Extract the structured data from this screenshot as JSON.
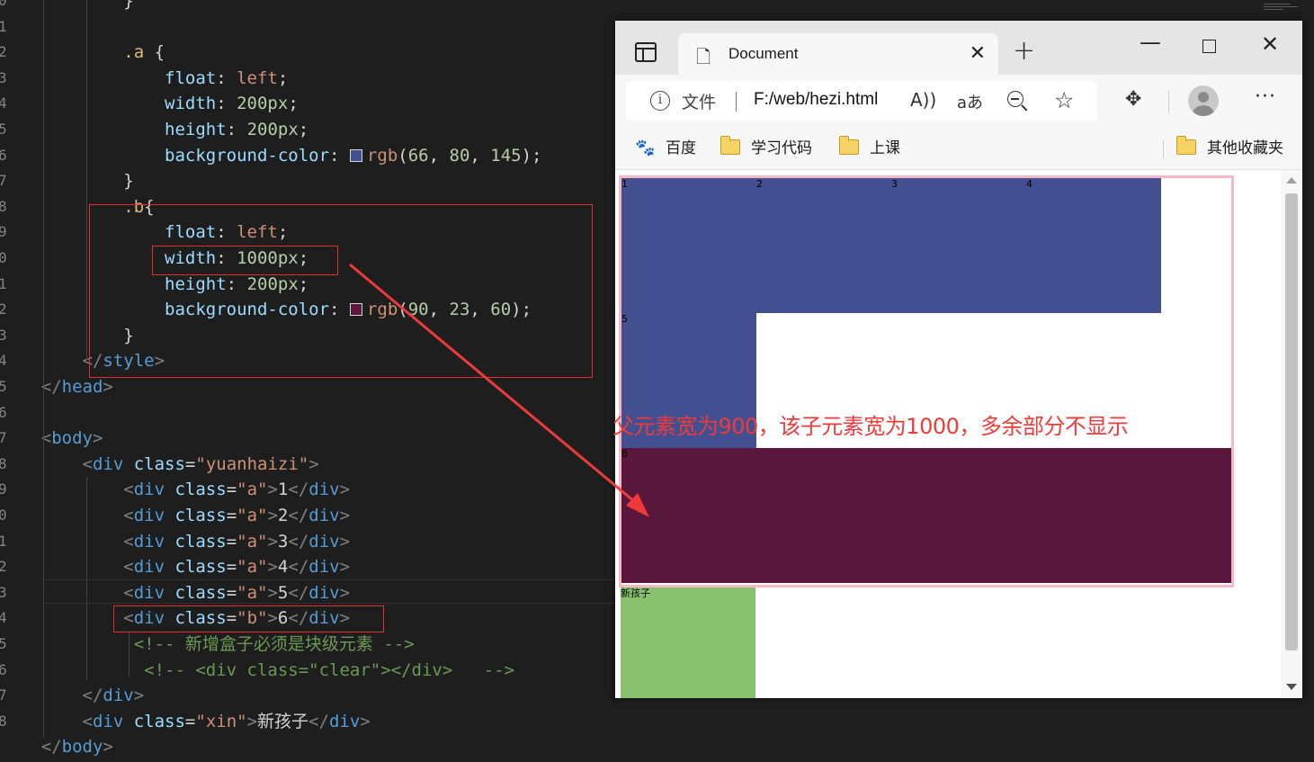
{
  "editor": {
    "gutter": [
      "0",
      "1",
      "2",
      "3",
      "4",
      "5",
      "6",
      "7",
      "8",
      "9",
      "0",
      "1",
      "2",
      "3",
      "4",
      "5",
      "6",
      "7",
      "8",
      "9",
      "0",
      "1",
      "2",
      "3",
      "4",
      "5",
      "6",
      "7",
      "8"
    ],
    "lines": [
      [
        {
          "c": "tk-text",
          "t": "            }"
        }
      ],
      [],
      [
        {
          "c": "tk-sel",
          "t": "            .a "
        },
        {
          "c": "tk-text",
          "t": "{"
        }
      ],
      [
        {
          "c": "tk-prop",
          "t": "                float"
        },
        {
          "c": "tk-text",
          "t": ": "
        },
        {
          "c": "tk-val",
          "t": "left"
        },
        {
          "c": "tk-text",
          "t": ";"
        }
      ],
      [
        {
          "c": "tk-prop",
          "t": "                width"
        },
        {
          "c": "tk-text",
          "t": ": "
        },
        {
          "c": "tk-num",
          "t": "200px"
        },
        {
          "c": "tk-text",
          "t": ";"
        }
      ],
      [
        {
          "c": "tk-prop",
          "t": "                height"
        },
        {
          "c": "tk-text",
          "t": ": "
        },
        {
          "c": "tk-num",
          "t": "200px"
        },
        {
          "c": "tk-text",
          "t": ";"
        }
      ],
      [
        {
          "c": "tk-prop",
          "t": "                background-color"
        },
        {
          "c": "tk-text",
          "t": ": "
        },
        {
          "swatch": "#425091"
        },
        {
          "c": "tk-val",
          "t": "rgb"
        },
        {
          "c": "tk-text",
          "t": "("
        },
        {
          "c": "tk-num",
          "t": "66"
        },
        {
          "c": "tk-text",
          "t": ", "
        },
        {
          "c": "tk-num",
          "t": "80"
        },
        {
          "c": "tk-text",
          "t": ", "
        },
        {
          "c": "tk-num",
          "t": "145"
        },
        {
          "c": "tk-text",
          "t": ");"
        }
      ],
      [
        {
          "c": "tk-text",
          "t": "            }"
        }
      ],
      [
        {
          "c": "tk-sel",
          "t": "            .b"
        },
        {
          "c": "tk-text",
          "t": "{"
        }
      ],
      [
        {
          "c": "tk-prop",
          "t": "                float"
        },
        {
          "c": "tk-text",
          "t": ": "
        },
        {
          "c": "tk-val",
          "t": "left"
        },
        {
          "c": "tk-text",
          "t": ";"
        }
      ],
      [
        {
          "c": "tk-prop",
          "t": "                width"
        },
        {
          "c": "tk-text",
          "t": ": "
        },
        {
          "c": "tk-num",
          "t": "1000px"
        },
        {
          "c": "tk-text",
          "t": ";"
        }
      ],
      [
        {
          "c": "tk-prop",
          "t": "                height"
        },
        {
          "c": "tk-text",
          "t": ": "
        },
        {
          "c": "tk-num",
          "t": "200px"
        },
        {
          "c": "tk-text",
          "t": ";"
        }
      ],
      [
        {
          "c": "tk-prop",
          "t": "                background-color"
        },
        {
          "c": "tk-text",
          "t": ": "
        },
        {
          "swatch": "#5a173c"
        },
        {
          "c": "tk-val",
          "t": "rgb"
        },
        {
          "c": "tk-text",
          "t": "("
        },
        {
          "c": "tk-num",
          "t": "90"
        },
        {
          "c": "tk-text",
          "t": ", "
        },
        {
          "c": "tk-num",
          "t": "23"
        },
        {
          "c": "tk-text",
          "t": ", "
        },
        {
          "c": "tk-num",
          "t": "60"
        },
        {
          "c": "tk-text",
          "t": ");"
        }
      ],
      [
        {
          "c": "tk-text",
          "t": "            }"
        }
      ],
      [
        {
          "c": "tk-punc",
          "t": "        </"
        },
        {
          "c": "tk-tag",
          "t": "style"
        },
        {
          "c": "tk-punc",
          "t": ">"
        }
      ],
      [
        {
          "c": "tk-punc",
          "t": "    </"
        },
        {
          "c": "tk-tag",
          "t": "head"
        },
        {
          "c": "tk-punc",
          "t": ">"
        }
      ],
      [],
      [
        {
          "c": "tk-punc",
          "t": "    <"
        },
        {
          "c": "tk-tag",
          "t": "body"
        },
        {
          "c": "tk-punc",
          "t": ">"
        }
      ],
      [
        {
          "c": "tk-punc",
          "t": "        <"
        },
        {
          "c": "tk-tag",
          "t": "div"
        },
        {
          "c": "tk-attr",
          "t": " class"
        },
        {
          "c": "tk-text",
          "t": "="
        },
        {
          "c": "tk-str",
          "t": "\"yuanhaizi\""
        },
        {
          "c": "tk-punc",
          "t": ">"
        }
      ],
      [
        {
          "c": "tk-punc",
          "t": "            <"
        },
        {
          "c": "tk-tag",
          "t": "div"
        },
        {
          "c": "tk-attr",
          "t": " class"
        },
        {
          "c": "tk-text",
          "t": "="
        },
        {
          "c": "tk-str",
          "t": "\"a\""
        },
        {
          "c": "tk-punc",
          "t": ">"
        },
        {
          "c": "tk-text",
          "t": "1"
        },
        {
          "c": "tk-punc",
          "t": "</"
        },
        {
          "c": "tk-tag",
          "t": "div"
        },
        {
          "c": "tk-punc",
          "t": ">"
        }
      ],
      [
        {
          "c": "tk-punc",
          "t": "            <"
        },
        {
          "c": "tk-tag",
          "t": "div"
        },
        {
          "c": "tk-attr",
          "t": " class"
        },
        {
          "c": "tk-text",
          "t": "="
        },
        {
          "c": "tk-str",
          "t": "\"a\""
        },
        {
          "c": "tk-punc",
          "t": ">"
        },
        {
          "c": "tk-text",
          "t": "2"
        },
        {
          "c": "tk-punc",
          "t": "</"
        },
        {
          "c": "tk-tag",
          "t": "div"
        },
        {
          "c": "tk-punc",
          "t": ">"
        }
      ],
      [
        {
          "c": "tk-punc",
          "t": "            <"
        },
        {
          "c": "tk-tag",
          "t": "div"
        },
        {
          "c": "tk-attr",
          "t": " class"
        },
        {
          "c": "tk-text",
          "t": "="
        },
        {
          "c": "tk-str",
          "t": "\"a\""
        },
        {
          "c": "tk-punc",
          "t": ">"
        },
        {
          "c": "tk-text",
          "t": "3"
        },
        {
          "c": "tk-punc",
          "t": "</"
        },
        {
          "c": "tk-tag",
          "t": "div"
        },
        {
          "c": "tk-punc",
          "t": ">"
        }
      ],
      [
        {
          "c": "tk-punc",
          "t": "            <"
        },
        {
          "c": "tk-tag",
          "t": "div"
        },
        {
          "c": "tk-attr",
          "t": " class"
        },
        {
          "c": "tk-text",
          "t": "="
        },
        {
          "c": "tk-str",
          "t": "\"a\""
        },
        {
          "c": "tk-punc",
          "t": ">"
        },
        {
          "c": "tk-text",
          "t": "4"
        },
        {
          "c": "tk-punc",
          "t": "</"
        },
        {
          "c": "tk-tag",
          "t": "div"
        },
        {
          "c": "tk-punc",
          "t": ">"
        }
      ],
      [
        {
          "c": "tk-punc",
          "t": "            <"
        },
        {
          "c": "tk-tag",
          "t": "div"
        },
        {
          "c": "tk-attr",
          "t": " class"
        },
        {
          "c": "tk-text",
          "t": "="
        },
        {
          "c": "tk-str",
          "t": "\"a\""
        },
        {
          "c": "tk-punc",
          "t": ">"
        },
        {
          "c": "tk-text",
          "t": "5"
        },
        {
          "c": "tk-punc",
          "t": "</"
        },
        {
          "c": "tk-tag",
          "t": "div"
        },
        {
          "c": "tk-punc",
          "t": ">"
        }
      ],
      [
        {
          "c": "tk-punc",
          "t": "            <"
        },
        {
          "c": "tk-tag",
          "t": "div"
        },
        {
          "c": "tk-attr",
          "t": " class"
        },
        {
          "c": "tk-text",
          "t": "="
        },
        {
          "c": "tk-str",
          "t": "\"b\""
        },
        {
          "c": "tk-punc",
          "t": ">"
        },
        {
          "c": "tk-text",
          "t": "6"
        },
        {
          "c": "tk-punc",
          "t": "</"
        },
        {
          "c": "tk-tag",
          "t": "div"
        },
        {
          "c": "tk-punc",
          "t": ">"
        }
      ],
      [
        {
          "c": "tk-cmt",
          "t": "             <!-- 新增盒子必须是块级元素 -->"
        }
      ],
      [
        {
          "c": "tk-cmt",
          "t": "              <!-- <div class=\"clear\"></div>   -->"
        }
      ],
      [
        {
          "c": "tk-punc",
          "t": "        </"
        },
        {
          "c": "tk-tag",
          "t": "div"
        },
        {
          "c": "tk-punc",
          "t": ">"
        }
      ],
      [
        {
          "c": "tk-punc",
          "t": "        <"
        },
        {
          "c": "tk-tag",
          "t": "div"
        },
        {
          "c": "tk-attr",
          "t": " class"
        },
        {
          "c": "tk-text",
          "t": "="
        },
        {
          "c": "tk-str",
          "t": "\"xin\""
        },
        {
          "c": "tk-punc",
          "t": ">"
        },
        {
          "c": "tk-text",
          "t": "新孩子"
        },
        {
          "c": "tk-punc",
          "t": "</"
        },
        {
          "c": "tk-tag",
          "t": "div"
        },
        {
          "c": "tk-punc",
          "t": ">"
        }
      ],
      [
        {
          "c": "tk-punc",
          "t": "    </"
        },
        {
          "c": "tk-tag",
          "t": "body"
        },
        {
          "c": "tk-punc",
          "t": ">"
        }
      ]
    ]
  },
  "browser": {
    "tab_title": "Document",
    "new_tab": "+",
    "address": {
      "file_label": "文件",
      "url": "F:/web/hezi.html"
    },
    "favorites": [
      "百度",
      "学习代码",
      "上课",
      "其他收藏夹"
    ],
    "page": {
      "a_boxes": [
        "1",
        "2",
        "3",
        "4",
        "5"
      ],
      "b_box": "6",
      "xin_label": "新孩子",
      "colors": {
        "a": "#425091",
        "b": "#5a173c",
        "xin": "#88c270",
        "parent_border": "#f5b8c4"
      }
    }
  },
  "annotation": {
    "text": "父元素宽为900，该子元素宽为1000，多余部分不显示",
    "color": "#f03a3a"
  },
  "icons": [
    "tab-actions-icon",
    "document-icon",
    "close-icon",
    "plus-icon",
    "minimize-icon",
    "maximize-icon",
    "info-icon",
    "read-aloud-icon",
    "translate-icon",
    "zoom-out-icon",
    "favorite-add-icon",
    "extensions-icon",
    "avatar",
    "more-icon",
    "baidu-paw-icon",
    "folder-icon"
  ]
}
